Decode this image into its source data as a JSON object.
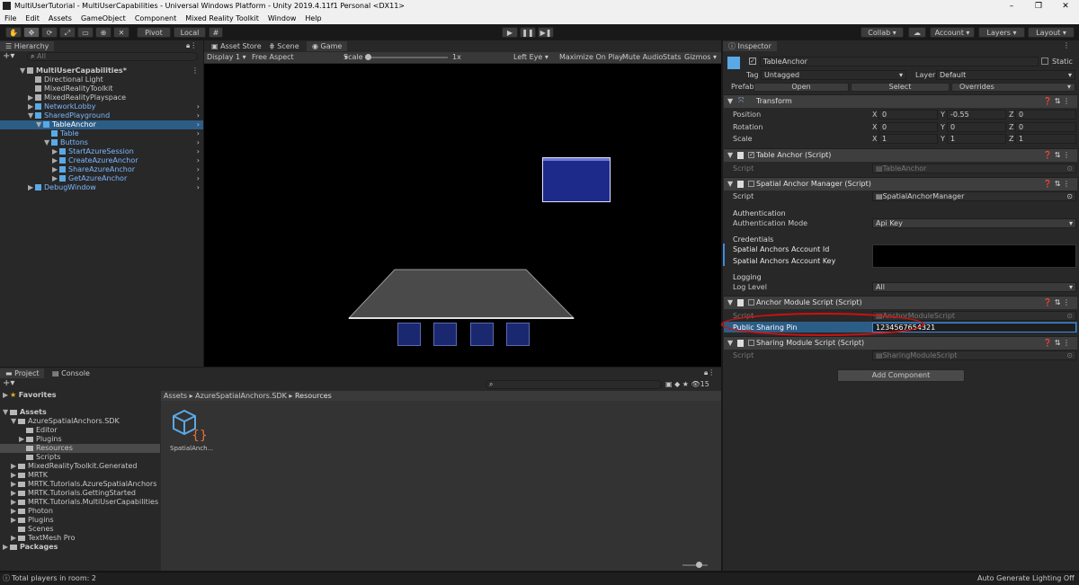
{
  "window": {
    "title": "MultiUserTutorial - MultiUserCapabilities - Universal Windows Platform - Unity 2019.4.11f1 Personal <DX11>",
    "min": "–",
    "max": "❐",
    "close": "✕"
  },
  "menu": [
    "File",
    "Edit",
    "Assets",
    "GameObject",
    "Component",
    "Mixed Reality Toolkit",
    "Window",
    "Help"
  ],
  "toolbar": {
    "pivot": "Pivot",
    "local": "Local",
    "collab": "Collab ▾",
    "account": "Account ▾",
    "layers": "Layers ▾",
    "layout": "Layout ▾"
  },
  "hierarchy": {
    "tab": "Hierarchy",
    "search": "All",
    "items": [
      {
        "label": "MultiUserCapabilities*",
        "indent": 0,
        "arrow": "▼",
        "kind": "scene"
      },
      {
        "label": "Directional Light",
        "indent": 1,
        "arrow": "",
        "kind": "g"
      },
      {
        "label": "MixedRealityToolkit",
        "indent": 1,
        "arrow": "",
        "kind": "g"
      },
      {
        "label": "MixedRealityPlayspace",
        "indent": 1,
        "arrow": "▶",
        "kind": "g"
      },
      {
        "label": "NetworkLobby",
        "indent": 1,
        "arrow": "▶",
        "kind": "b"
      },
      {
        "label": "SharedPlayground",
        "indent": 1,
        "arrow": "▼",
        "kind": "b"
      },
      {
        "label": "TableAnchor",
        "indent": 2,
        "arrow": "▼",
        "kind": "b",
        "selected": true
      },
      {
        "label": "Table",
        "indent": 3,
        "arrow": "",
        "kind": "b"
      },
      {
        "label": "Buttons",
        "indent": 3,
        "arrow": "▼",
        "kind": "b"
      },
      {
        "label": "StartAzureSession",
        "indent": 4,
        "arrow": "▶",
        "kind": "b"
      },
      {
        "label": "CreateAzureAnchor",
        "indent": 4,
        "arrow": "▶",
        "kind": "b"
      },
      {
        "label": "ShareAzureAnchor",
        "indent": 4,
        "arrow": "▶",
        "kind": "b"
      },
      {
        "label": "GetAzureAnchor",
        "indent": 4,
        "arrow": "▶",
        "kind": "b"
      },
      {
        "label": "DebugWindow",
        "indent": 1,
        "arrow": "▶",
        "kind": "b"
      }
    ]
  },
  "game": {
    "tabs": [
      "Asset Store",
      "Scene",
      "Game"
    ],
    "display": "Display 1",
    "aspect": "Free Aspect",
    "scale_label": "Scale",
    "scale_value": "1x",
    "eye": "Left Eye",
    "maximize": "Maximize On Play",
    "mute": "Mute Audio",
    "stats": "Stats",
    "gizmos": "Gizmos"
  },
  "inspector": {
    "tab": "Inspector",
    "object_name": "TableAnchor",
    "static": "Static",
    "tag_label": "Tag",
    "tag": "Untagged",
    "layer_label": "Layer",
    "layer": "Default",
    "prefab_label": "Prefab",
    "open": "Open",
    "select": "Select",
    "overrides": "Overrides",
    "transform": {
      "title": "Transform",
      "position": {
        "label": "Position",
        "x": "0",
        "y": "-0.55",
        "z": "0"
      },
      "rotation": {
        "label": "Rotation",
        "x": "0",
        "y": "0",
        "z": "0"
      },
      "scale": {
        "label": "Scale",
        "x": "1",
        "y": "1",
        "z": "1"
      }
    },
    "table_anchor": {
      "title": "Table Anchor (Script)",
      "script_label": "Script",
      "script": "TableAnchor"
    },
    "spatial": {
      "title": "Spatial Anchor Manager (Script)",
      "script_label": "Script",
      "script": "SpatialAnchorManager",
      "auth_header": "Authentication",
      "auth_mode_label": "Authentication Mode",
      "auth_mode": "Api Key",
      "cred_header": "Credentials",
      "account_id": "Spatial Anchors Account Id",
      "account_key": "Spatial Anchors Account Key",
      "log_header": "Logging",
      "log_level_label": "Log Level",
      "log_level": "All"
    },
    "anchor_module": {
      "title": "Anchor Module Script (Script)",
      "script_label": "Script",
      "script": "AnchorModuleScript",
      "pin_label": "Public Sharing Pin",
      "pin": "1234567654321"
    },
    "sharing": {
      "title": "Sharing Module Script (Script)",
      "script_label": "Script",
      "script": "SharingModuleScript"
    },
    "add_component": "Add Component"
  },
  "project": {
    "tabs": [
      "Project",
      "Console"
    ],
    "favorites": "Favorites",
    "assets": "Assets",
    "packages": "Packages",
    "tree": [
      {
        "label": "AzureSpatialAnchors.SDK",
        "indent": 1,
        "arrow": "▼"
      },
      {
        "label": "Editor",
        "indent": 2,
        "arrow": ""
      },
      {
        "label": "Plugins",
        "indent": 2,
        "arrow": "▶"
      },
      {
        "label": "Resources",
        "indent": 2,
        "arrow": "",
        "selected": true
      },
      {
        "label": "Scripts",
        "indent": 2,
        "arrow": ""
      },
      {
        "label": "MixedRealityToolkit.Generated",
        "indent": 1,
        "arrow": "▶"
      },
      {
        "label": "MRTK",
        "indent": 1,
        "arrow": "▶"
      },
      {
        "label": "MRTK.Tutorials.AzureSpatialAnchors",
        "indent": 1,
        "arrow": "▶"
      },
      {
        "label": "MRTK.Tutorials.GettingStarted",
        "indent": 1,
        "arrow": "▶"
      },
      {
        "label": "MRTK.Tutorials.MultiUserCapabilities",
        "indent": 1,
        "arrow": "▶"
      },
      {
        "label": "Photon",
        "indent": 1,
        "arrow": "▶"
      },
      {
        "label": "Plugins",
        "indent": 1,
        "arrow": "▶"
      },
      {
        "label": "Scenes",
        "indent": 1,
        "arrow": ""
      },
      {
        "label": "TextMesh Pro",
        "indent": 1,
        "arrow": "▶"
      }
    ],
    "breadcrumb": [
      "Assets",
      "AzureSpatialAnchors.SDK",
      "Resources"
    ],
    "asset_name": "SpatialAnch...",
    "count": "15"
  },
  "status": {
    "left": "Total players in room: 2",
    "right": "Auto Generate Lighting Off"
  },
  "colors": {
    "accent": "#2c5d87",
    "highlight_ring": "#d01010",
    "game_window": "#1e2a8a"
  }
}
